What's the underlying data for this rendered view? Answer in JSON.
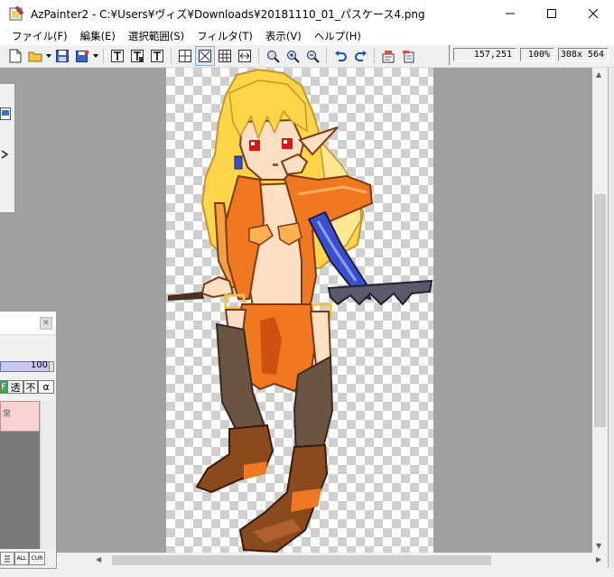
{
  "window": {
    "title": "AzPainter2 - C:¥Users¥ヴィズ¥Downloads¥20181110_01_パスケース4.png",
    "controls": [
      "minimize",
      "maximize",
      "close"
    ]
  },
  "menu": [
    "ファイル(F)",
    "編集(E)",
    "選択範囲(S)",
    "フィルタ(T)",
    "表示(V)",
    "ヘルプ(H)"
  ],
  "toolbar": {
    "icons": [
      "new-file-icon",
      "open-folder-icon",
      "save-icon",
      "save-as-icon",
      "text-tool-icon",
      "text-tool-2-icon",
      "text-tool-3-icon",
      "grid-fit-icon",
      "fit-window-icon",
      "grid-icon",
      "flip-horizontal-icon",
      "zoom-icon",
      "zoom-in-icon",
      "zoom-out-icon",
      "undo-icon",
      "redo-icon",
      "brush-option-icon",
      "layer-option-icon"
    ],
    "cursor_pos": "157,251",
    "zoom": "100%",
    "image_size": "308x 564"
  },
  "colors": {
    "canvas_bg": "#a0a0a0",
    "hair": "#ffd54a",
    "outfit": "#f07820",
    "boots": "#8a4a1e",
    "stockings": "#6a5444",
    "blade": "#3a4fc8"
  },
  "layer_panel": {
    "opacity": "100",
    "buttons": [
      "F",
      "透",
      "不",
      "α"
    ],
    "layer_mode": "常",
    "bottom_buttons": [
      "ALL",
      "CUR"
    ]
  }
}
